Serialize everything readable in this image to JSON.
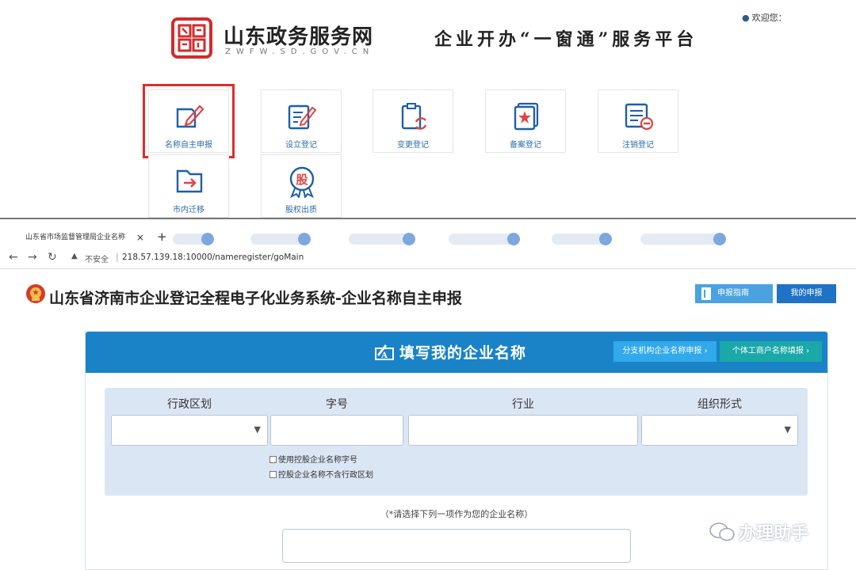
{
  "portal": {
    "site_name": "山东政务服务网",
    "site_url": "ZWFW.SD.GOV.CN",
    "platform_title": "企业开办“一窗通”服务平台",
    "welcome": "欢迎您：",
    "tiles": [
      {
        "label": "名称自主申报",
        "icon": "name-declare-icon",
        "highlighted": true
      },
      {
        "label": "设立登记",
        "icon": "establish-icon"
      },
      {
        "label": "变更登记",
        "icon": "change-icon"
      },
      {
        "label": "备案登记",
        "icon": "filing-icon"
      },
      {
        "label": "注销登记",
        "icon": "cancel-icon"
      },
      {
        "label": "市内迁移",
        "icon": "migrate-icon"
      },
      {
        "label": "股权出质",
        "icon": "equity-pledge-icon"
      }
    ]
  },
  "browser": {
    "tab_title": "山东省市场监督管理局企业名称",
    "close_glyph": "×",
    "new_tab_glyph": "+",
    "insecure_label": "不安全",
    "url": "218.57.139.18:10000/nameregister/goMain"
  },
  "page": {
    "system_title": "山东省济南市企业登记全程电子化业务系统-企业名称自主申报",
    "guide_button": "申报指南",
    "my_button": "我的申报",
    "card_title": "填写我的企业名称",
    "branch_button": "分支机构企业名称申报",
    "individual_button": "个体工商户名称填报",
    "columns": {
      "region": "行政区划",
      "trade_name": "字号",
      "industry": "行业",
      "org_form": "组织形式"
    },
    "checkbox_1": "使用控股企业名称字号",
    "checkbox_2": "控股企业名称不含行政区划",
    "choose_hint": "（*请选择下列一项作为您的企业名称）"
  },
  "watermark": "办理助手",
  "colors": {
    "header_blue": "#1a83c7",
    "highlight_red": "#e02b2b",
    "panel_bg": "#dbe6f5",
    "link_blue": "#2b6cb0"
  }
}
